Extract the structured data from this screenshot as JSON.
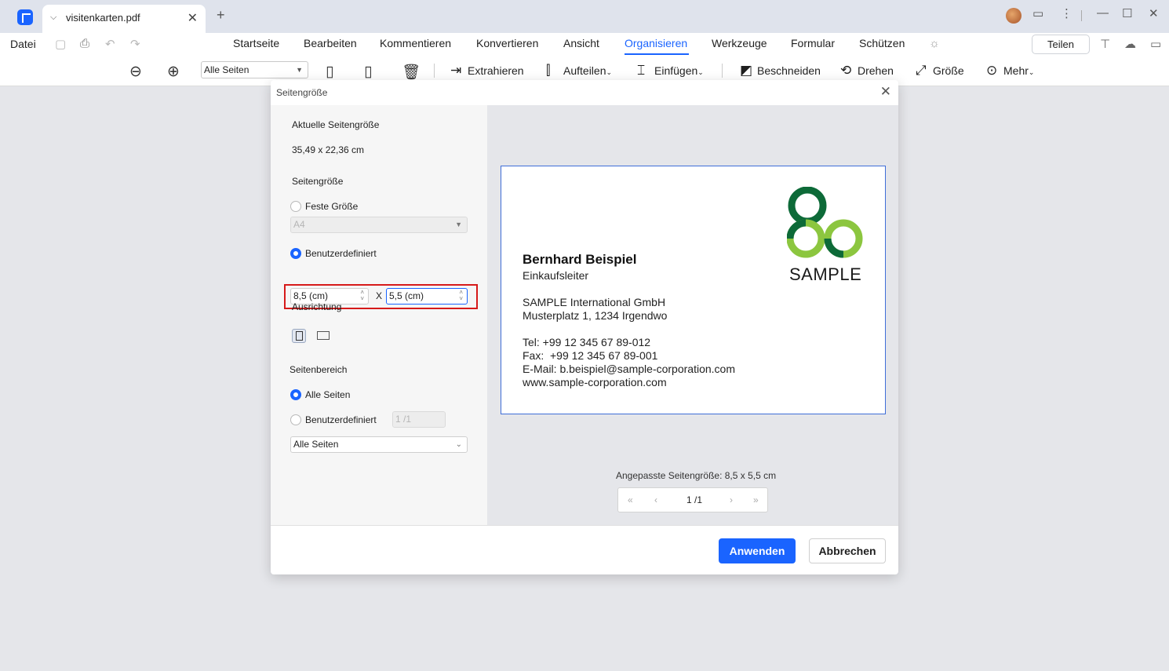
{
  "titlebar": {
    "tab_title": "visitenkarten.pdf",
    "new_tab": "+",
    "close": "✕",
    "win_minimize": "—",
    "win_maximize": "☐",
    "win_close": "✕"
  },
  "menu": {
    "file": "Datei",
    "items": [
      "Startseite",
      "Bearbeiten",
      "Kommentieren",
      "Konvertieren",
      "Ansicht",
      "Organisieren",
      "Werkzeuge",
      "Formular",
      "Schützen"
    ],
    "active": "Organisieren",
    "share": "Teilen"
  },
  "toolbar": {
    "page_select": "Alle Seiten",
    "extract": "Extrahieren",
    "split": "Aufteilen",
    "insert": "Einfügen",
    "crop": "Beschneiden",
    "rotate": "Drehen",
    "size": "Größe",
    "more": "Mehr"
  },
  "dialog": {
    "title": "Seitengröße",
    "current_size_label": "Aktuelle Seitengröße",
    "current_size_value": "35,49 x 22,36 cm",
    "page_size_label": "Seitengröße",
    "fixed_size_label": "Feste Größe",
    "fixed_size_value": "A4",
    "custom_label": "Benutzerdefiniert",
    "width_value": "8,5 (cm)",
    "times": "X",
    "height_value": "5,5 (cm)",
    "orientation_label": "Ausrichtung",
    "range_label": "Seitenbereich",
    "all_pages_label": "Alle Seiten",
    "custom_range_label": "Benutzerdefiniert",
    "custom_range_value": "1 /1",
    "range_select": "Alle Seiten",
    "preview_caption": "Angepasste Seitengröße: 8,5 x 5,5 cm",
    "pager": {
      "first": "«",
      "prev": "‹",
      "page": "1 /1",
      "next": "›",
      "last": "»"
    },
    "apply": "Anwenden",
    "cancel": "Abbrechen"
  },
  "card": {
    "name": "Bernhard Beispiel",
    "role": "Einkaufsleiter",
    "company": "SAMPLE International GmbH",
    "address": "Musterplatz 1, 1234 Irgendwo",
    "tel": "Tel: +99 12 345 67 89-012",
    "fax": "Fax:  +99 12 345 67 89-001",
    "email": "E-Mail: b.beispiel@sample-corporation.com",
    "web": "www.sample-corporation.com",
    "logo_text": "SAMPLE",
    "logo_colors": [
      "#0d6a38",
      "#8cc63f"
    ]
  },
  "colors": {
    "accent": "#1a64ff",
    "highlight": "#d61a1a"
  }
}
